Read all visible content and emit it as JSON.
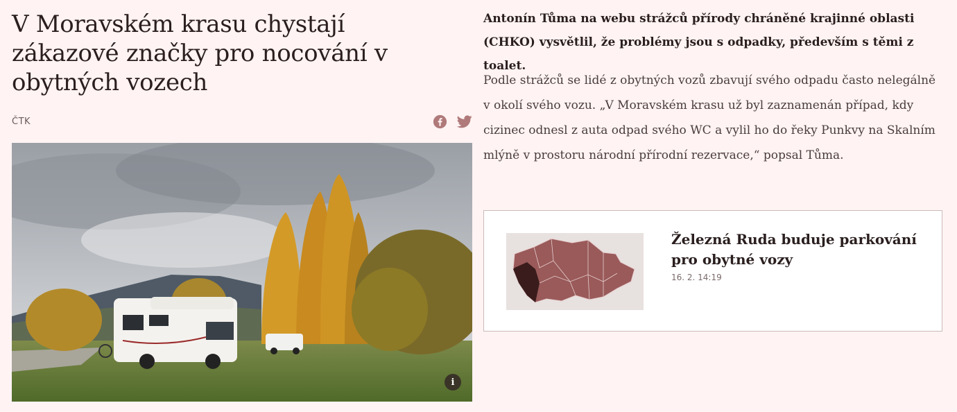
{
  "article": {
    "headline": "V Moravském krasu chystají zákazové značky pro nocování v obytných vozech",
    "source": "ČTK",
    "share": {
      "facebook_icon": "facebook-icon",
      "twitter_icon": "twitter-icon"
    },
    "photo": {
      "info_label": "i"
    },
    "lead": "Antonín Tůma na webu strážců přírody chráněné krajinné oblasti (CHKO) vysvětlil, že problémy jsou s odpadky, především s těmi z toalet.",
    "paragraph": "Podle strážců se lidé z obytných vozů zbavují svého odpadu často nelegálně v okolí svého vozu. „V Moravském krasu už byl zaznamenán případ, kdy cizinec odnesl z auta odpad svého WC a vylil ho do řeky Punkvy na Skalním mlýně v prostoru národní přírodní rezervace,“ popsal Tůma."
  },
  "related": {
    "title": "Železná Ruda buduje parkování pro obytné vozy",
    "date": "16. 2. 14:19"
  },
  "colors": {
    "background": "#fff3f3",
    "share_icon": "#b07a7a",
    "map_region": "#9a5a5a",
    "map_highlight": "#3a1c1c"
  }
}
